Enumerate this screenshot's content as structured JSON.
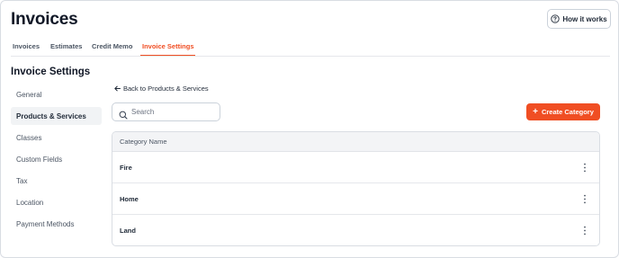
{
  "header": {
    "title": "Invoices",
    "how_it_works_label": "How it works"
  },
  "tabs": [
    {
      "label": "Invoices"
    },
    {
      "label": "Estimates"
    },
    {
      "label": "Credit Memo"
    },
    {
      "label": "Invoice Settings",
      "active": true
    }
  ],
  "settings": {
    "title": "Invoice Settings",
    "sidebar": [
      {
        "label": "General"
      },
      {
        "label": "Products & Services",
        "active": true
      },
      {
        "label": "Classes"
      },
      {
        "label": "Custom Fields"
      },
      {
        "label": "Tax"
      },
      {
        "label": "Location"
      },
      {
        "label": "Payment Methods"
      }
    ]
  },
  "main": {
    "back_label": "Back to Products & Services",
    "search_placeholder": "Search",
    "create_label": "Create Category",
    "table": {
      "header": "Category Name",
      "rows": [
        "Fire",
        "Home",
        "Land"
      ]
    }
  },
  "colors": {
    "accent": "#f04e23",
    "border": "#d9dde3",
    "table_header_bg": "#f3f4f6"
  },
  "icons": [
    "question-circle-icon",
    "arrow-left-icon",
    "search-icon",
    "plus-icon",
    "kebab-menu-icon"
  ]
}
